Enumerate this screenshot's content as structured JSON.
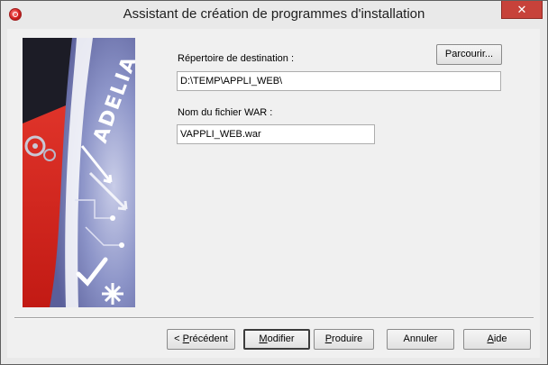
{
  "window": {
    "title": "Assistant de création de programmes d'installation",
    "close_glyph": "✕",
    "icon": "adelia-app-icon"
  },
  "banner": {
    "brand_text": "ADELIA",
    "colors": {
      "red": "#d4251c",
      "dark": "#1c1c26",
      "blue": "#8c94c8",
      "white": "#ffffff"
    }
  },
  "form": {
    "destination_label": "Répertoire de destination :",
    "destination_value": "D:\\TEMP\\APPLI_WEB\\",
    "browse_label": "Parcourir...",
    "war_label": "Nom du fichier WAR :",
    "war_value": "VAPPLI_WEB.war"
  },
  "buttons": {
    "previous": {
      "prefix": "< ",
      "accel": "P",
      "rest": "récédent"
    },
    "modify": {
      "accel": "M",
      "rest": "odifier"
    },
    "produce": {
      "accel": "P",
      "rest": "roduire"
    },
    "cancel": "Annuler",
    "help": {
      "accel": "A",
      "rest": "ide"
    }
  }
}
